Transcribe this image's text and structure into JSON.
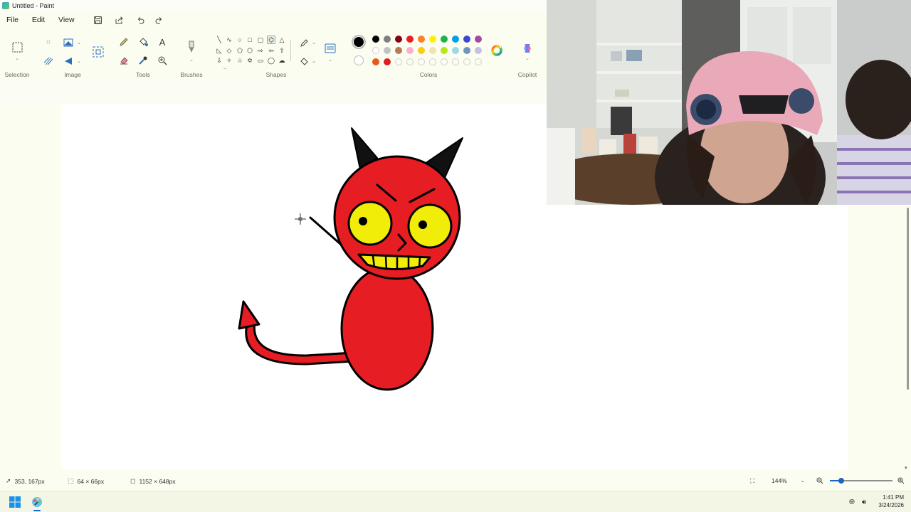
{
  "window": {
    "title": "Untitled - Paint"
  },
  "menu": {
    "file": "File",
    "edit": "Edit",
    "view": "View"
  },
  "ribbon": {
    "groups": {
      "selection": "Selection",
      "image": "Image",
      "tools": "Tools",
      "brushes": "Brushes",
      "shapes": "Shapes",
      "colors": "Colors",
      "copilot": "Copilot"
    },
    "palette": {
      "row1": [
        "#000000",
        "#7f7f7f",
        "#880015",
        "#ed1c24",
        "#ff7f27",
        "#fff200",
        "#22b14c",
        "#00a2e8",
        "#3f48cc",
        "#a349a4"
      ],
      "row2": [
        "#ffffff",
        "#c3c3c3",
        "#b97a57",
        "#ffaec9",
        "#ffc90e",
        "#efe4b0",
        "#b5e61d",
        "#99d9ea",
        "#7092be",
        "#c8bfe7"
      ],
      "row3": [
        "#e8591a",
        "#e02020"
      ],
      "primary": "#000000",
      "secondary": "#ffffff"
    }
  },
  "status": {
    "cursor_pos": "353, 167px",
    "selection_size": "64 × 66px",
    "canvas_size": "1152 × 648px",
    "zoom": "144%"
  },
  "taskbar": {
    "time": "1:41 PM",
    "date": "3/24/2026"
  },
  "drawing": {
    "body_color": "#e71d24",
    "eye_color": "#f2ec09"
  }
}
